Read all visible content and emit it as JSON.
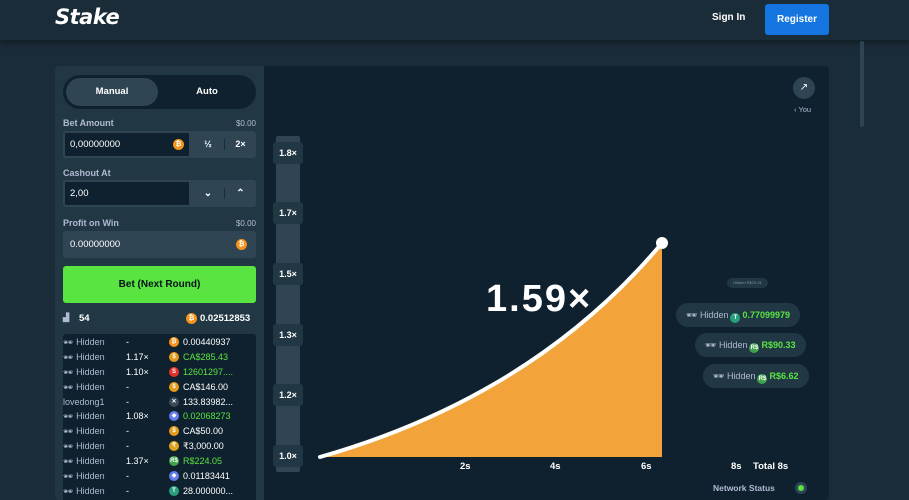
{
  "header": {
    "logo": "Stake",
    "signin_label": "Sign In",
    "register_label": "Register"
  },
  "controls": {
    "mode_tabs": [
      "Manual",
      "Auto"
    ],
    "bet_amount_label": "Bet Amount",
    "bet_amount_usd": "$0.00",
    "bet_amount_value": "0,00000000",
    "half_label": "½",
    "double_label": "2×",
    "cashout_label": "Cashout At",
    "cashout_value": "2,00",
    "profit_label": "Profit on Win",
    "profit_usd": "$0.00",
    "profit_value": "0.00000000",
    "bet_button": "Bet (Next Round)"
  },
  "stats": {
    "players": "54",
    "total": "0.02512853"
  },
  "players": [
    {
      "name": "Hidden",
      "hidden": true,
      "mult": "-",
      "icon": "btc",
      "value": "0.00440937",
      "green": false
    },
    {
      "name": "Hidden",
      "hidden": true,
      "mult": "1.17×",
      "icon": "cad",
      "value": "CA$285.43",
      "green": true
    },
    {
      "name": "Hidden",
      "hidden": true,
      "mult": "1.10×",
      "icon": "shib",
      "value": "12601297....",
      "green": true
    },
    {
      "name": "Hidden",
      "hidden": true,
      "mult": "-",
      "icon": "cad",
      "value": "CA$146.00",
      "green": false
    },
    {
      "name": "lovedong1",
      "hidden": false,
      "mult": "-",
      "icon": "xrp",
      "value": "133.83982...",
      "green": false
    },
    {
      "name": "Hidden",
      "hidden": true,
      "mult": "1.08×",
      "icon": "eth",
      "value": "0.02068273",
      "green": true
    },
    {
      "name": "Hidden",
      "hidden": true,
      "mult": "-",
      "icon": "cad",
      "value": "CA$50.00",
      "green": false
    },
    {
      "name": "Hidden",
      "hidden": true,
      "mult": "-",
      "icon": "inr",
      "value": "₹3,000.00",
      "green": false
    },
    {
      "name": "Hidden",
      "hidden": true,
      "mult": "1.37×",
      "icon": "brl",
      "value": "R$224.05",
      "green": true
    },
    {
      "name": "Hidden",
      "hidden": true,
      "mult": "-",
      "icon": "eth",
      "value": "0.01183441",
      "green": false
    },
    {
      "name": "Hidden",
      "hidden": true,
      "mult": "-",
      "icon": "usdt",
      "value": "28.000000...",
      "green": false
    }
  ],
  "icon_colors": {
    "btc": "#f7931a",
    "cad": "#e39b1b",
    "shib": "#e4312b",
    "xrp": "#3b4a56",
    "eth": "#627eea",
    "inr": "#e0a21a",
    "brl": "#3fa34d",
    "usdt": "#26a17b"
  },
  "icon_glyphs": {
    "btc": "₿",
    "cad": "$",
    "shib": "S",
    "xrp": "✕",
    "eth": "◆",
    "inr": "₹",
    "brl": "R$",
    "usdt": "T"
  },
  "chart": {
    "you_label": "‹ You",
    "y_ticks": [
      "1.8×",
      "1.7×",
      "1.5×",
      "1.3×",
      "1.2×",
      "1.0×"
    ],
    "x_ticks": [
      "2s",
      "4s",
      "6s",
      "8s"
    ],
    "total_label": "Total 8s",
    "current_multiplier": "1.59×",
    "network_status": "Network Status"
  },
  "payouts": [
    {
      "name": "Hidden",
      "icon": "usdt",
      "value": "0.77099979"
    },
    {
      "name": "Hidden",
      "icon": "brl",
      "value": "R$90.33"
    },
    {
      "name": "Hidden",
      "icon": "brl",
      "value": "R$6.62"
    }
  ],
  "mini_payout": "Hidden R$23.91",
  "colors": {
    "accent_green": "#5ae442",
    "brand_blue": "#1475e1",
    "curve_fill": "#f2a33a"
  }
}
